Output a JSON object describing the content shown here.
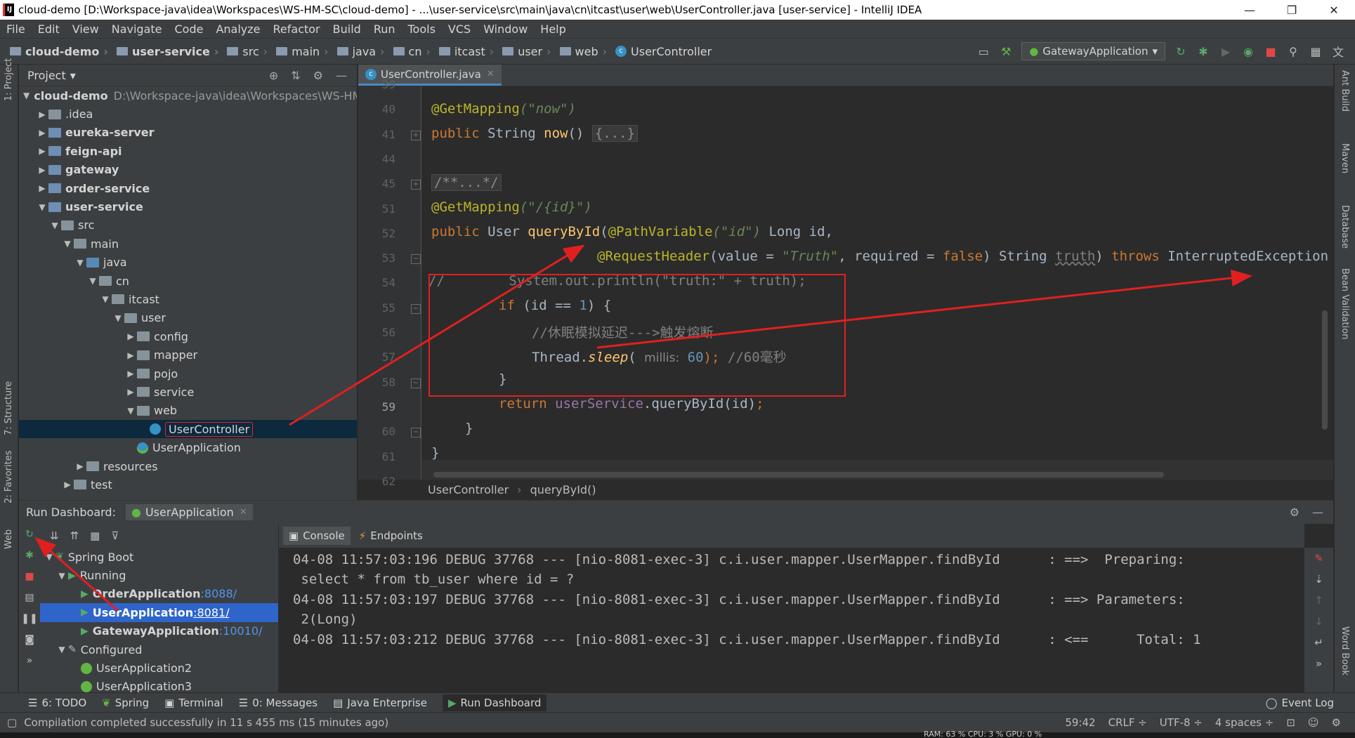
{
  "window": {
    "title": "cloud-demo [D:\\Workspace-java\\idea\\Workspaces\\WS-HM-SC\\cloud-demo] - ...\\user-service\\src\\main\\java\\cn\\itcast\\user\\web\\UserController.java [user-service] - IntelliJ IDEA",
    "minimize": "—",
    "maximize": "❐",
    "close": "✕"
  },
  "menu": [
    "File",
    "Edit",
    "View",
    "Navigate",
    "Code",
    "Analyze",
    "Refactor",
    "Build",
    "Run",
    "Tools",
    "VCS",
    "Window",
    "Help"
  ],
  "breadcrumbs": [
    "cloud-demo",
    "user-service",
    "src",
    "main",
    "java",
    "cn",
    "itcast",
    "user",
    "web",
    "UserController"
  ],
  "run_config": "GatewayApplication",
  "project_panel": {
    "title": "Project",
    "tree": [
      {
        "label": "cloud-demo",
        "path": "D:\\Workspace-java\\idea\\Workspaces\\WS-HM-",
        "bold": true,
        "indent": 0,
        "arrow": "▼"
      },
      {
        "label": ".idea",
        "indent": 1,
        "arrow": "▶"
      },
      {
        "label": "eureka-server",
        "bold": true,
        "indent": 1,
        "arrow": "▶"
      },
      {
        "label": "feign-api",
        "bold": true,
        "indent": 1,
        "arrow": "▶"
      },
      {
        "label": "gateway",
        "bold": true,
        "indent": 1,
        "arrow": "▶"
      },
      {
        "label": "order-service",
        "bold": true,
        "indent": 1,
        "arrow": "▶"
      },
      {
        "label": "user-service",
        "bold": true,
        "indent": 1,
        "arrow": "▼"
      },
      {
        "label": "src",
        "indent": 2,
        "arrow": "▼"
      },
      {
        "label": "main",
        "indent": 3,
        "arrow": "▼"
      },
      {
        "label": "java",
        "indent": 4,
        "arrow": "▼"
      },
      {
        "label": "cn",
        "indent": 5,
        "arrow": "▼"
      },
      {
        "label": "itcast",
        "indent": 6,
        "arrow": "▼"
      },
      {
        "label": "user",
        "indent": 7,
        "arrow": "▼"
      },
      {
        "label": "config",
        "indent": 8,
        "arrow": "▶"
      },
      {
        "label": "mapper",
        "indent": 8,
        "arrow": "▶"
      },
      {
        "label": "pojo",
        "indent": 8,
        "arrow": "▶"
      },
      {
        "label": "service",
        "indent": 8,
        "arrow": "▶"
      },
      {
        "label": "web",
        "indent": 8,
        "arrow": "▼"
      },
      {
        "label": "UserController",
        "indent": 9,
        "arrow": "",
        "selected": true,
        "kind": "class"
      },
      {
        "label": "UserApplication",
        "indent": 8,
        "arrow": "",
        "kind": "app"
      },
      {
        "label": "resources",
        "indent": 4,
        "arrow": "▶"
      },
      {
        "label": "test",
        "indent": 3,
        "arrow": "▶"
      }
    ]
  },
  "editor": {
    "tab": "UserController.java",
    "line_numbers": [
      "39",
      "40",
      "41",
      "44",
      "45",
      "51",
      "52",
      "53",
      "54",
      "55",
      "56",
      "57",
      "58",
      "59",
      "60",
      "61",
      "62"
    ],
    "current_line": "59",
    "code": {
      "l40_ann": "@GetMapping",
      "l40_str": "(\"now\")",
      "l41_kw": "public",
      "l41_type": " String ",
      "l41_fn": "now",
      "l41_paren": "() ",
      "l41_collapsed": "{...}",
      "l45": "/**...*/",
      "l51_ann": "@GetMapping",
      "l51_str": "(\"/{id}\")",
      "l52_kw": "public",
      "l52_type": " User ",
      "l52_fn": "queryById",
      "l52_p1": "(",
      "l52_ann": "@PathVariable",
      "l52_str": "(\"id\")",
      "l52_rest": " Long id,",
      "l53_ann": "@RequestHeader",
      "l53_a": "(value = ",
      "l53_str": "\"Truth\"",
      "l53_b": ", required = ",
      "l53_kw": "false",
      "l53_c": ") String ",
      "l53_var": "truth",
      "l53_d": ") ",
      "l53_throws": "throws",
      "l53_e": " InterruptedException {",
      "l54": "//        System.out.println(\"truth:\" + truth);",
      "l55_kw": "if",
      "l55_a": " (id == ",
      "l55_num": "1",
      "l55_b": ") {",
      "l56": "//休眠模拟延迟--->触发熔断",
      "l57_a": "Thread.",
      "l57_fn": "sleep",
      "l57_b": "( ",
      "l57_hint": "millis:",
      "l57_num": " 60",
      "l57_c": ");",
      "l57_cmt": " //60毫秒",
      "l58": "}",
      "l59_kw": "return",
      "l59_fld": " userService",
      "l59_a": ".queryById(id)",
      "l59_semi": ";",
      "l60": "}",
      "l61": "}"
    },
    "crumbs": [
      "UserController",
      "queryById()"
    ]
  },
  "run_dashboard": {
    "title": "Run Dashboard:",
    "tab": "UserApplication",
    "tree": [
      {
        "label": "Spring Boot",
        "indent": 0,
        "arrow": "▼"
      },
      {
        "label": "Running",
        "indent": 1,
        "arrow": "▼",
        "running": true
      },
      {
        "label": "OrderApplication",
        "port": ":8088/",
        "indent": 2,
        "bold": true,
        "running": true
      },
      {
        "label": "UserApplication",
        "port": ":8081/",
        "indent": 2,
        "bold": true,
        "running": true,
        "selected": true
      },
      {
        "label": "GatewayApplication",
        "port": ":10010/",
        "indent": 2,
        "bold": true,
        "running": true
      },
      {
        "label": "Configured",
        "indent": 1,
        "arrow": "▼"
      },
      {
        "label": "UserApplication2",
        "indent": 2
      },
      {
        "label": "UserApplication3",
        "indent": 2
      }
    ],
    "console_tabs": [
      "Console",
      "Endpoints"
    ],
    "console_lines": [
      "04-08 11:57:03:196 DEBUG 37768 --- [nio-8081-exec-3] c.i.user.mapper.UserMapper.findById      : ==>  Preparing:",
      " select * from tb_user where id = ?",
      "04-08 11:57:03:197 DEBUG 37768 --- [nio-8081-exec-3] c.i.user.mapper.UserMapper.findById      : ==> Parameters:",
      " 2(Long)",
      "04-08 11:57:03:212 DEBUG 37768 --- [nio-8081-exec-3] c.i.user.mapper.UserMapper.findById      : <==      Total: 1"
    ]
  },
  "left_tools": [
    "1: Project",
    "7: Structure",
    "2: Favorites",
    "Web"
  ],
  "right_tools": [
    "Ant Build",
    "Maven",
    "Database",
    "Bean Validation",
    "Word Book"
  ],
  "bottom_tabs": [
    "6: TODO",
    "Spring",
    "Terminal",
    "0: Messages",
    "Java Enterprise",
    "Run Dashboard"
  ],
  "event_log": "Event Log",
  "status": {
    "message": "Compilation completed successfully in 11 s 455 ms (15 minutes ago)",
    "position": "59:42",
    "line_sep": "CRLF ÷",
    "encoding": "UTF-8 ÷",
    "indent": "4 spaces ÷"
  },
  "memory": "RAM: 63 %  CPU: 3 %    GPU: 0 %",
  "colors": {
    "accent": "#4a88c7",
    "annotation_red": "#e02020",
    "selection": "#2f65ca"
  }
}
